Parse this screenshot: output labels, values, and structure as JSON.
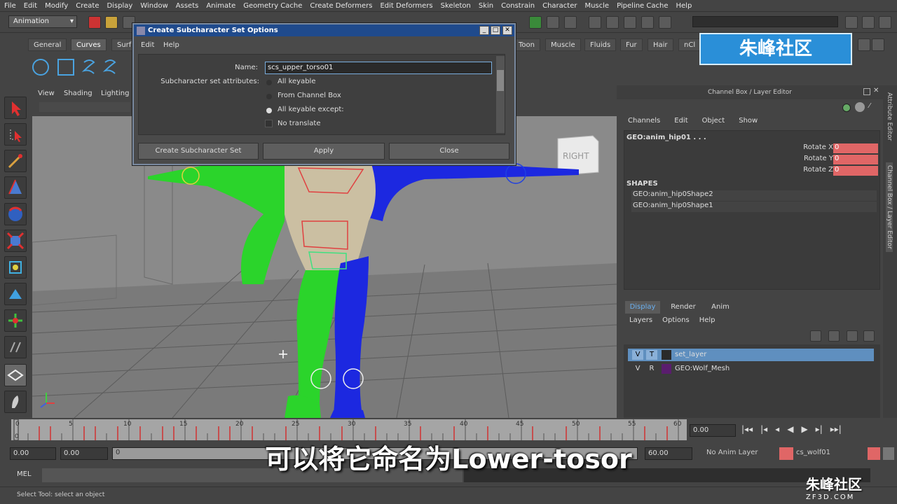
{
  "menubar": {
    "items": [
      "File",
      "Edit",
      "Modify",
      "Create",
      "Display",
      "Window",
      "Assets",
      "Animate",
      "Geometry Cache",
      "Create Deformers",
      "Edit Deformers",
      "Skeleton",
      "Skin",
      "Constrain",
      "Character",
      "Muscle",
      "Pipeline Cache",
      "Help"
    ]
  },
  "statusline": {
    "mode": "Animation"
  },
  "shelf": {
    "tabs": [
      "General",
      "Curves",
      "Surf",
      "Toon",
      "Muscle",
      "Fluids",
      "Fur",
      "Hair",
      "nCl"
    ],
    "active_tab": "Curves"
  },
  "viewport": {
    "menu": [
      "View",
      "Shading",
      "Lighting"
    ],
    "viewcube_label": "RIGHT"
  },
  "dialog": {
    "title": "Create Subcharacter Set Options",
    "menu": [
      "Edit",
      "Help"
    ],
    "name_label": "Name:",
    "name_value": "scs_upper_torso01",
    "attributes_label": "Subcharacter set attributes:",
    "options": [
      "All keyable",
      "From Channel Box",
      "All keyable except:"
    ],
    "selected_option": "All keyable except:",
    "checkbox_label": "No translate",
    "buttons": [
      "Create Subcharacter Set",
      "Apply",
      "Close"
    ]
  },
  "channel_box": {
    "title": "Channel Box / Layer Editor",
    "menu": [
      "Channels",
      "Edit",
      "Object",
      "Show"
    ],
    "object": "GEO:anim_hip01 . . .",
    "attributes": [
      {
        "name": "Rotate X",
        "value": "0"
      },
      {
        "name": "Rotate Y",
        "value": "0"
      },
      {
        "name": "Rotate Z",
        "value": "0"
      }
    ],
    "shapes_header": "SHAPES",
    "shapes": [
      "GEO:anim_hip0Shape2",
      "GEO:anim_hip0Shape1"
    ]
  },
  "layer_editor": {
    "tabs": [
      "Display",
      "Render",
      "Anim"
    ],
    "active_tab": "Display",
    "menu": [
      "Layers",
      "Options",
      "Help"
    ],
    "layers": [
      {
        "v": "V",
        "t": "T",
        "name": "set_layer",
        "color": "#2a2a2a",
        "selected": true
      },
      {
        "v": "V",
        "t": "R",
        "name": "GEO:Wolf_Mesh",
        "color": "#5a1d6e",
        "selected": false
      }
    ]
  },
  "side_tabs": [
    "Attribute Editor",
    "Channel Box / Layer Editor"
  ],
  "timeline": {
    "ticks": [
      "0",
      "5",
      "10",
      "15",
      "20",
      "25",
      "30",
      "35",
      "40",
      "45",
      "50",
      "55",
      "60"
    ],
    "current_time": "0.00",
    "current_frame": "0"
  },
  "range": {
    "start": "0.00",
    "playback_start": "0.00",
    "range_start": "0",
    "range_end": "60.00",
    "anim_layer": "No Anim Layer",
    "character_set": "cs_wolf01"
  },
  "mel": {
    "label": "MEL"
  },
  "help_line": "Select Tool: select an object",
  "subtitle": "可以将它命名为Lower-tosor",
  "watermark": {
    "top": "朱峰社区",
    "bottom": "朱峰社区",
    "bottom_url": "ZF3D.COM"
  },
  "colors": {
    "title_bar": "#1f4a8c",
    "selected_layer": "#5f8fbf",
    "keyed_field": "#e06666",
    "watermark_blue": "#2a8fd8"
  }
}
